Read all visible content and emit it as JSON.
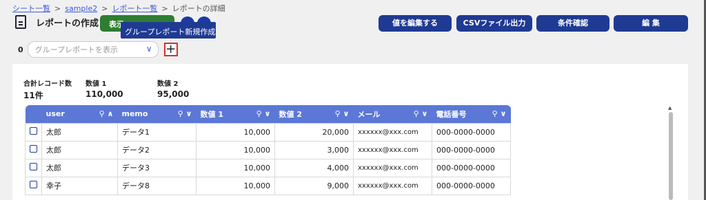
{
  "breadcrumb": {
    "items": [
      "シート一覧",
      "sample2",
      "レポート一覧",
      "レポートの詳細"
    ],
    "separator": ">"
  },
  "header": {
    "title": "レポートの作成",
    "green_button": "表示",
    "tooltip": "グループレポート新規作成",
    "buttons": [
      "値を編集する",
      "CSVファイル出力",
      "条件確認",
      "編 集"
    ]
  },
  "group_select": {
    "count": "0",
    "placeholder": "グループレポートを表示"
  },
  "summary": {
    "total_label": "合計レコード数",
    "total_value": "11件",
    "num1_label": "数値 1",
    "num1_value": "110,000",
    "num2_label": "数値 2",
    "num2_value": "95,000"
  },
  "table": {
    "columns": [
      "user",
      "memo",
      "数値 1",
      "数値 2",
      "メール",
      "電話番号"
    ],
    "rows": [
      [
        "太郎",
        "データ1",
        "10,000",
        "20,000",
        "xxxxxx@xxx.com",
        "000-0000-0000"
      ],
      [
        "太郎",
        "データ2",
        "10,000",
        "3,000",
        "xxxxxx@xxx.com",
        "000-0000-0000"
      ],
      [
        "太郎",
        "データ3",
        "10,000",
        "4,000",
        "xxxxxx@xxx.com",
        "000-0000-0000"
      ],
      [
        "幸子",
        "データ8",
        "10,000",
        "9,000",
        "xxxxxx@xxx.com",
        "000-0000-0000"
      ]
    ]
  },
  "colors": {
    "primary": "#1f3a93",
    "header": "#5b78d6",
    "green": "#2f7d32",
    "highlight": "#d32f2f"
  }
}
